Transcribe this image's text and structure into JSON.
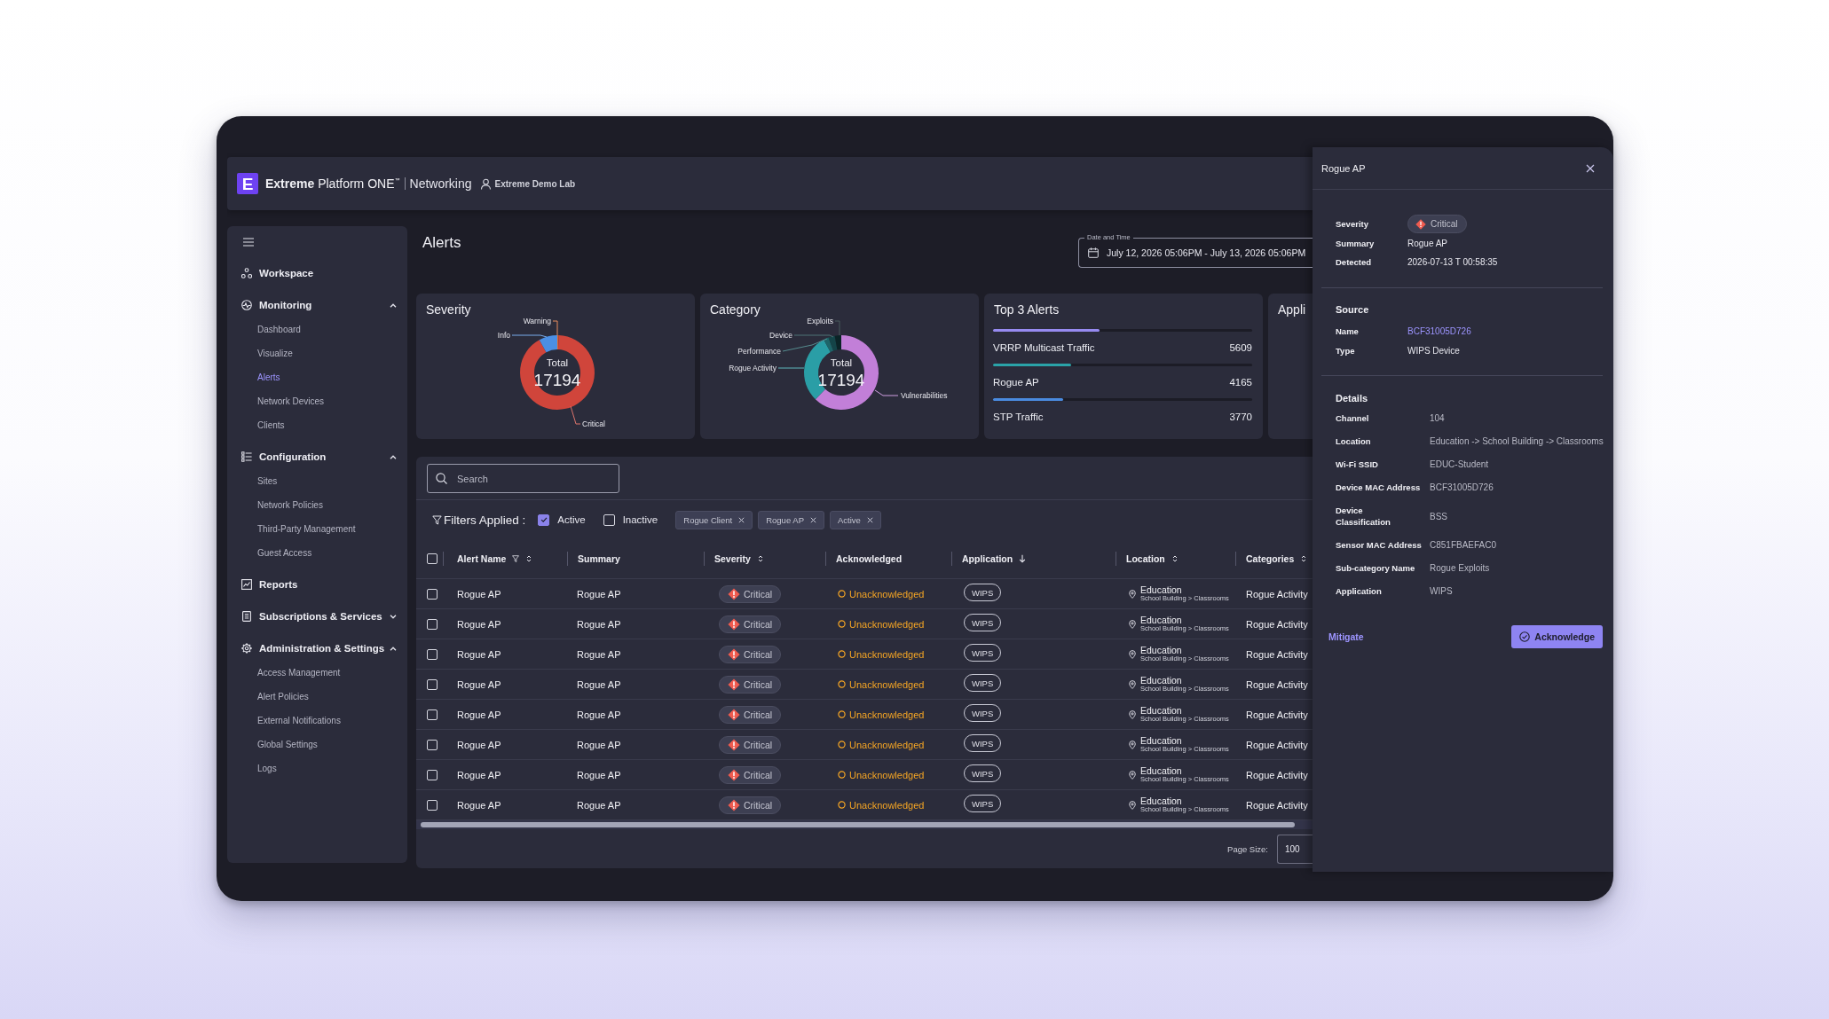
{
  "header": {
    "logo": "E",
    "brand": "**Extreme** Platform ONE$^{™}$",
    "product": "Networking",
    "tenant": "Extreme Demo Lab"
  },
  "sidebar": {
    "items": [
      {
        "label": "Workspace",
        "selected": false
      },
      {
        "label": "Monitoring",
        "selected": false,
        "expanded": true,
        "children": [
          {
            "label": "Dashboard",
            "selected": false
          },
          {
            "label": "Visualize",
            "selected": false
          },
          {
            "label": "Alerts",
            "selected": true
          },
          {
            "label": "Network Devices",
            "selected": false
          },
          {
            "label": "Clients",
            "selected": false
          }
        ]
      },
      {
        "label": "Configuration",
        "selected": false,
        "expanded": true,
        "children": [
          {
            "label": "Sites",
            "selected": false
          },
          {
            "label": "Network Policies",
            "selected": false
          },
          {
            "label": "Third-Party Management",
            "selected": false
          },
          {
            "label": "Guest Access",
            "selected": false
          }
        ]
      },
      {
        "label": "Reports",
        "selected": false
      },
      {
        "label": "Subscriptions & Services",
        "selected": false,
        "expanded": false
      },
      {
        "label": "Administration & Settings",
        "selected": false,
        "expanded": true,
        "children": [
          {
            "label": "Access Management",
            "selected": false
          },
          {
            "label": "Alert Policies",
            "selected": false
          },
          {
            "label": "External Notifications",
            "selected": false
          },
          {
            "label": "Global Settings",
            "selected": false
          },
          {
            "label": "Logs",
            "selected": false
          }
        ]
      }
    ]
  },
  "page_title": "Alerts",
  "date_range": {
    "label": "Date and Time",
    "value": "July 12, 2026 05:06PM - July 13, 2026 05:06PM"
  },
  "cards": [
    {
      "kind": "donut",
      "title": "Severity",
      "center_label": "Total",
      "center_value": "17194",
      "chart_data": {
        "type": "donut",
        "categories": [
          "Warning",
          "Critical",
          "Info"
        ],
        "values": [
          0.6,
          91.4,
          8.0
        ],
        "colors": [
          "#e0662a",
          "#d0453b",
          "#4b8fe4"
        ]
      }
    },
    {
      "kind": "donut",
      "title": "Category",
      "center_label": "Total",
      "center_value": "17194",
      "chart_data": {
        "type": "donut",
        "categories": [
          "Vulnerabilities",
          "Rogue Activity",
          "Performance",
          "Device",
          "Exploits"
        ],
        "values": [
          62.2,
          30.0,
          2.2,
          2.8,
          2.8
        ],
        "colors": [
          "#c27fd8",
          "#2a9ea6",
          "#1e6569",
          "#144448",
          "#0b2427"
        ]
      }
    },
    {
      "kind": "top_list",
      "title": "Top 3 Alerts",
      "items": [
        {
          "name": "VRRP Multicast Traffic",
          "value": "5609",
          "level": 0.41,
          "color": "#968af0"
        },
        {
          "name": "Rogue AP",
          "value": "4165",
          "level": 0.3,
          "color": "#2aa3a8"
        },
        {
          "name": "STP Traffic",
          "value": "3770",
          "level": 0.27,
          "color": "#4a8be0"
        }
      ]
    },
    {
      "kind": "cut_off",
      "title": "Appli"
    }
  ],
  "table": {
    "search": {
      "placeholder": "Search"
    },
    "filters": {
      "label": "Filters Applied :",
      "toggles": [
        {
          "label": "Active",
          "checked": true
        },
        {
          "label": "Inactive",
          "checked": false
        }
      ],
      "chips": [
        "Rogue Client",
        "Rogue AP",
        "Active"
      ]
    },
    "select_all": {
      "checked": false
    },
    "columns": [
      {
        "label": "Alert Name",
        "filterable": true,
        "sortable": true,
        "sorted": false
      },
      {
        "label": "Summary",
        "filterable": false,
        "sortable": false,
        "sorted": false
      },
      {
        "label": "Severity",
        "filterable": false,
        "sortable": true,
        "sorted": false
      },
      {
        "label": "Acknowledged",
        "filterable": false,
        "sortable": false,
        "sorted": false
      },
      {
        "label": "Application",
        "filterable": false,
        "sortable": true,
        "sorted": true
      },
      {
        "label": "Location",
        "filterable": false,
        "sortable": true,
        "sorted": false
      },
      {
        "label": "Categories",
        "filterable": false,
        "sortable": true,
        "sorted": false
      }
    ],
    "rows": [
      {
        "checked": false,
        "alert_name": "Rogue AP",
        "summary": "Rogue AP",
        "severity": "Critical",
        "acknowledged": false,
        "acknowledgement": "Unacknowledged",
        "application": "WIPS",
        "location": {
          "site": "Education",
          "path": "School Building > Classrooms"
        },
        "category": "Rogue Activity"
      },
      {
        "checked": false,
        "alert_name": "Rogue AP",
        "summary": "Rogue AP",
        "severity": "Critical",
        "acknowledged": false,
        "acknowledgement": "Unacknowledged",
        "application": "WIPS",
        "location": {
          "site": "Education",
          "path": "School Building > Classrooms"
        },
        "category": "Rogue Activity"
      },
      {
        "checked": false,
        "alert_name": "Rogue AP",
        "summary": "Rogue AP",
        "severity": "Critical",
        "acknowledged": false,
        "acknowledgement": "Unacknowledged",
        "application": "WIPS",
        "location": {
          "site": "Education",
          "path": "School Building > Classrooms"
        },
        "category": "Rogue Activity"
      },
      {
        "checked": false,
        "alert_name": "Rogue AP",
        "summary": "Rogue AP",
        "severity": "Critical",
        "acknowledged": false,
        "acknowledgement": "Unacknowledged",
        "application": "WIPS",
        "location": {
          "site": "Education",
          "path": "School Building > Classrooms"
        },
        "category": "Rogue Activity"
      },
      {
        "checked": false,
        "alert_name": "Rogue AP",
        "summary": "Rogue AP",
        "severity": "Critical",
        "acknowledged": false,
        "acknowledgement": "Unacknowledged",
        "application": "WIPS",
        "location": {
          "site": "Education",
          "path": "School Building > Classrooms"
        },
        "category": "Rogue Activity"
      },
      {
        "checked": false,
        "alert_name": "Rogue AP",
        "summary": "Rogue AP",
        "severity": "Critical",
        "acknowledged": false,
        "acknowledgement": "Unacknowledged",
        "application": "WIPS",
        "location": {
          "site": "Education",
          "path": "School Building > Classrooms"
        },
        "category": "Rogue Activity"
      },
      {
        "checked": false,
        "alert_name": "Rogue AP",
        "summary": "Rogue AP",
        "severity": "Critical",
        "acknowledged": false,
        "acknowledgement": "Unacknowledged",
        "application": "WIPS",
        "location": {
          "site": "Education",
          "path": "School Building > Classrooms"
        },
        "category": "Rogue Activity"
      },
      {
        "checked": false,
        "alert_name": "Rogue AP",
        "summary": "Rogue AP",
        "severity": "Critical",
        "acknowledged": false,
        "acknowledgement": "Unacknowledged",
        "application": "WIPS",
        "location": {
          "site": "Education",
          "path": "School Building > Classrooms"
        },
        "category": "Rogue Activity"
      }
    ],
    "page_size": {
      "label": "Page Size:",
      "value": "100"
    }
  },
  "detail_panel": {
    "title": "Rogue AP",
    "sections": [
      {
        "fields": [
          {
            "label": "Severity",
            "value": "Critical",
            "kind": "severity"
          },
          {
            "label": "Summary",
            "value": "Rogue AP",
            "kind": "text"
          },
          {
            "label": "Detected",
            "value": "2026-07-13 T 00:58:35",
            "kind": "text"
          }
        ]
      },
      {
        "heading": "Source",
        "fields": [
          {
            "label": "Name",
            "value": "BCF31005D726",
            "kind": "link"
          },
          {
            "label": "Type",
            "value": "WIPS Device",
            "kind": "text"
          }
        ]
      },
      {
        "heading": "Details",
        "fields": [
          {
            "label": "Channel",
            "value": "104",
            "kind": "text"
          },
          {
            "label": "Location",
            "value": "Education -> School Building -> Classrooms",
            "kind": "text"
          },
          {
            "label": "Wi-Fi SSID",
            "value": "EDUC-Student",
            "kind": "text"
          },
          {
            "label": "Device MAC Address",
            "value": "BCF31005D726",
            "kind": "text"
          },
          {
            "label": "Device\nClassification",
            "value": "BSS",
            "kind": "text"
          },
          {
            "label": "Sensor MAC Address",
            "value": "C851FBAEFAC0",
            "kind": "text"
          },
          {
            "label": "Sub-category Name",
            "value": "Rogue Exploits",
            "kind": "text"
          },
          {
            "label": "Application",
            "value": "WIPS",
            "kind": "text"
          }
        ]
      }
    ],
    "actions": {
      "secondary": "Mitigate",
      "primary": "Acknowledge"
    }
  }
}
